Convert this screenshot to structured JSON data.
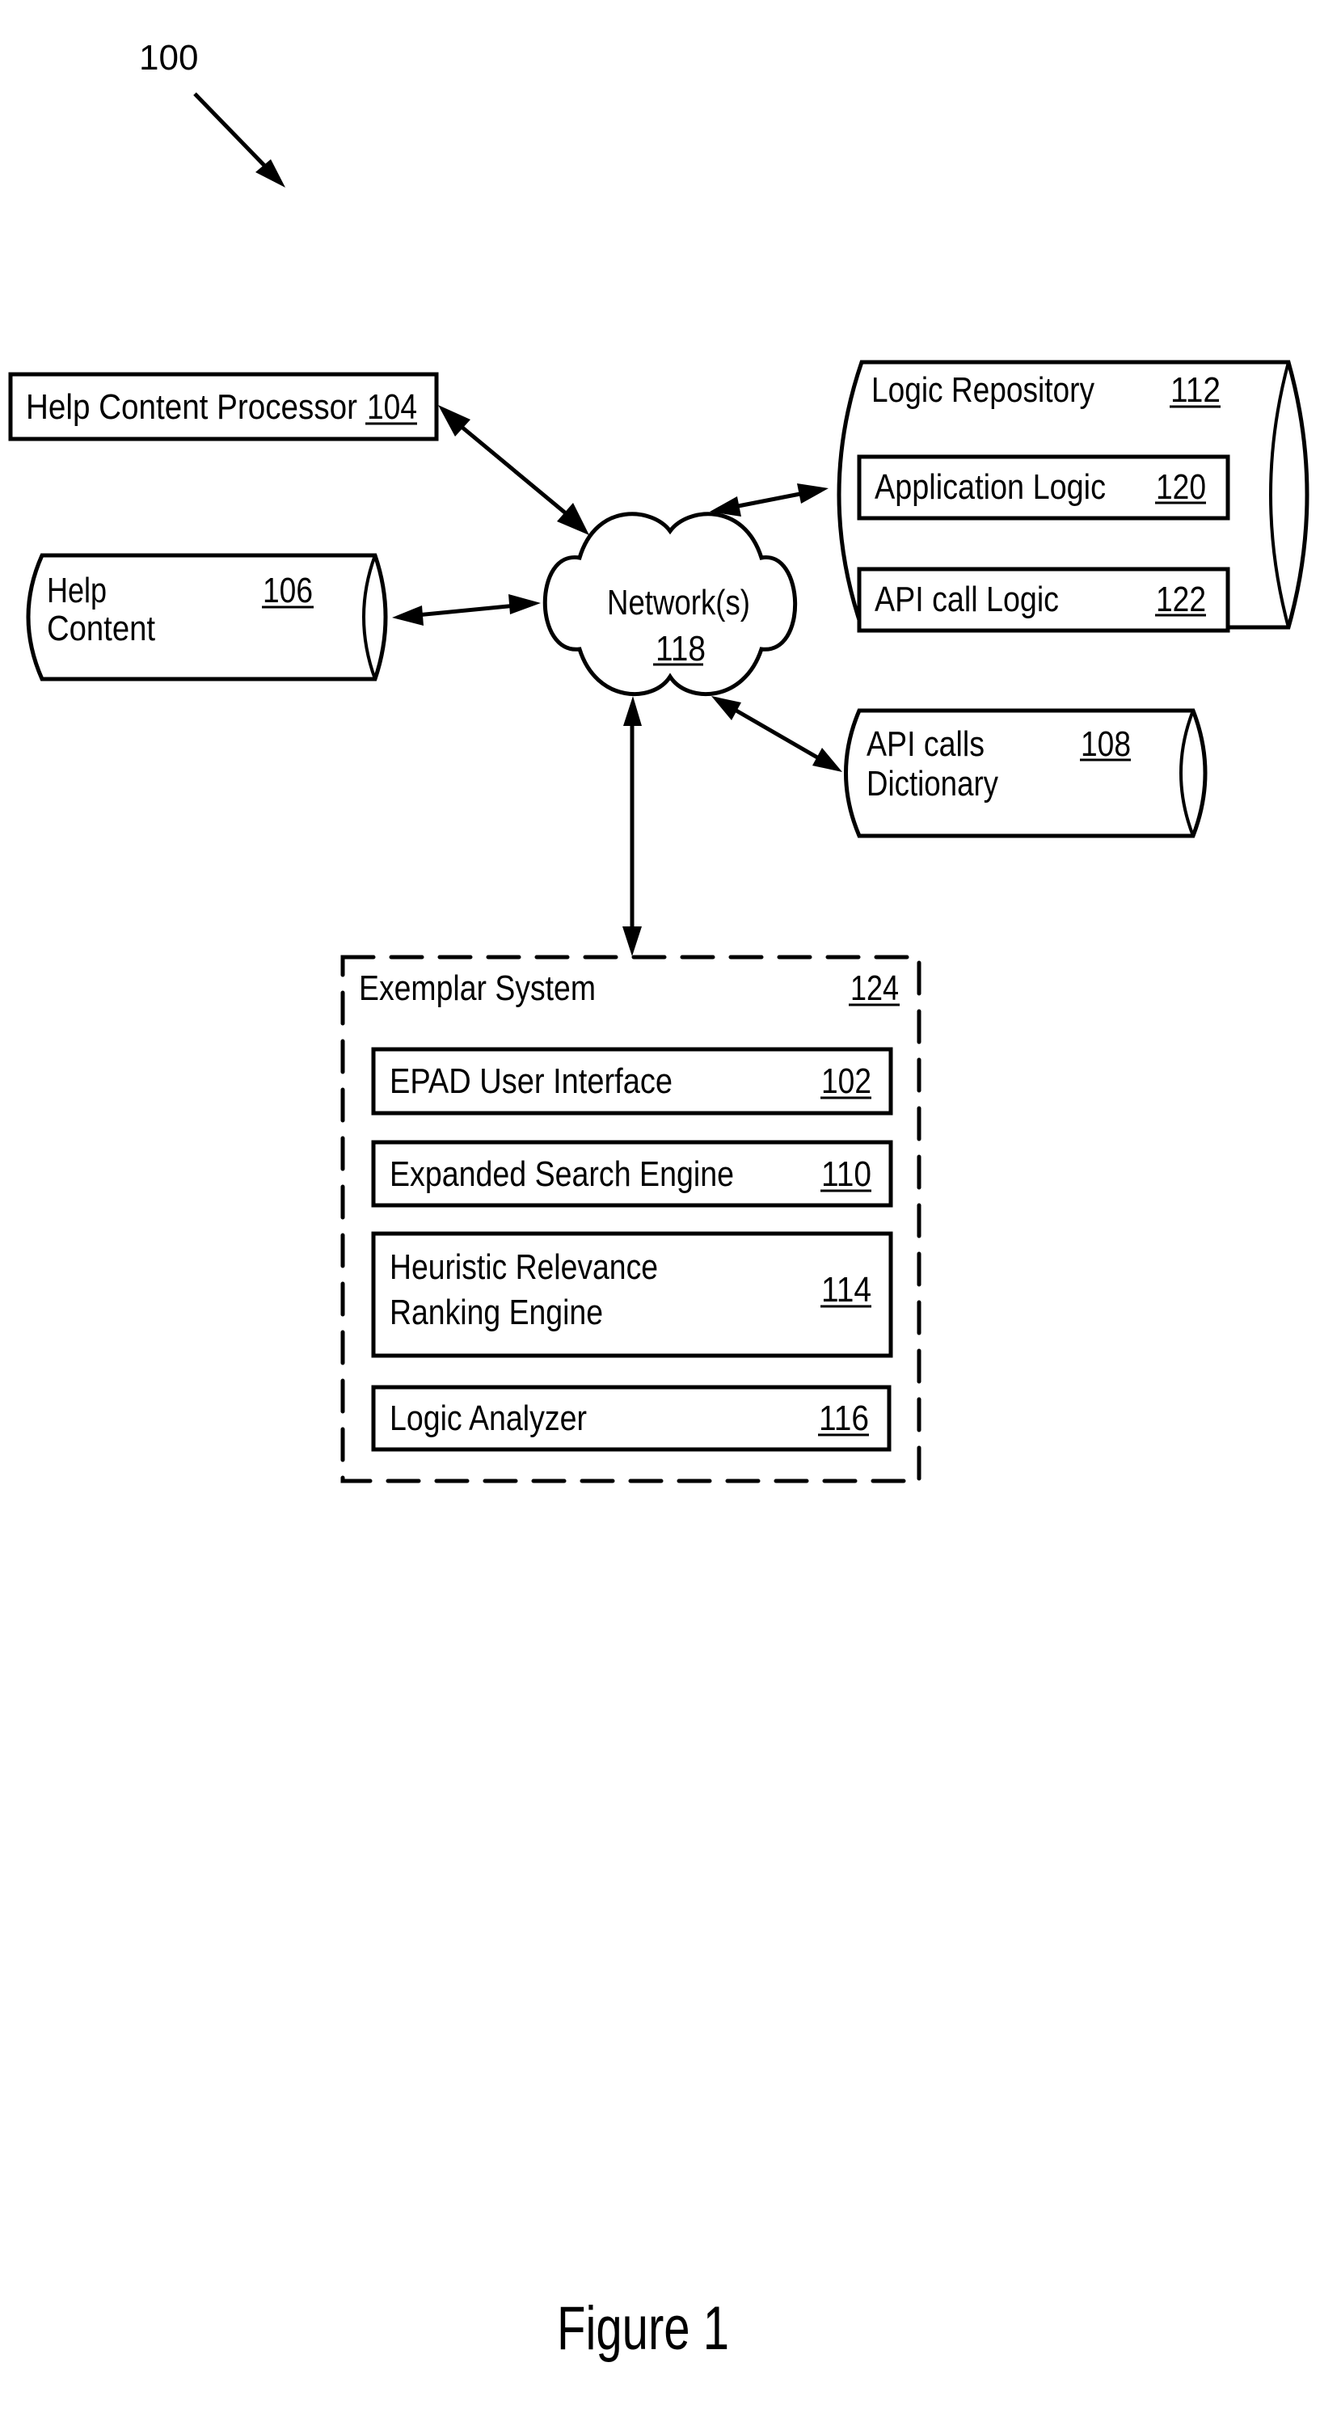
{
  "figure": {
    "reference": "100",
    "caption": "Figure 1"
  },
  "nodes": {
    "help_content_processor": {
      "label": "Help Content Processor",
      "ref": "104",
      "shape": "rectangle"
    },
    "help_content": {
      "label_lines": [
        "Help",
        "Content"
      ],
      "ref": "106",
      "shape": "cylinder"
    },
    "network": {
      "label": "Network(s)",
      "ref": "118",
      "shape": "cloud"
    },
    "logic_repository": {
      "label": "Logic Repository",
      "ref": "112",
      "shape": "cylinder",
      "children": [
        {
          "label": "Application Logic",
          "ref": "120"
        },
        {
          "label": "API call Logic",
          "ref": "122"
        }
      ]
    },
    "api_calls_dictionary": {
      "label_lines": [
        "API calls",
        "Dictionary"
      ],
      "ref": "108",
      "shape": "cylinder"
    },
    "exemplar_system": {
      "label": "Exemplar System",
      "ref": "124",
      "shape": "dashed-rectangle",
      "children": [
        {
          "label_lines": [
            "EPAD User Interface"
          ],
          "ref": "102"
        },
        {
          "label_lines": [
            "Expanded Search Engine"
          ],
          "ref": "110"
        },
        {
          "label_lines": [
            "Heuristic Relevance",
            "Ranking Engine"
          ],
          "ref": "114"
        },
        {
          "label_lines": [
            "Logic Analyzer"
          ],
          "ref": "116"
        }
      ]
    }
  },
  "edges": [
    {
      "from": "help_content_processor",
      "to": "network",
      "direction": "bidirectional"
    },
    {
      "from": "help_content",
      "to": "network",
      "direction": "bidirectional"
    },
    {
      "from": "network",
      "to": "logic_repository",
      "direction": "bidirectional"
    },
    {
      "from": "network",
      "to": "api_calls_dictionary",
      "direction": "bidirectional"
    },
    {
      "from": "network",
      "to": "exemplar_system",
      "direction": "bidirectional"
    }
  ],
  "colors": {
    "ink": "#000000",
    "background": "#ffffff"
  }
}
